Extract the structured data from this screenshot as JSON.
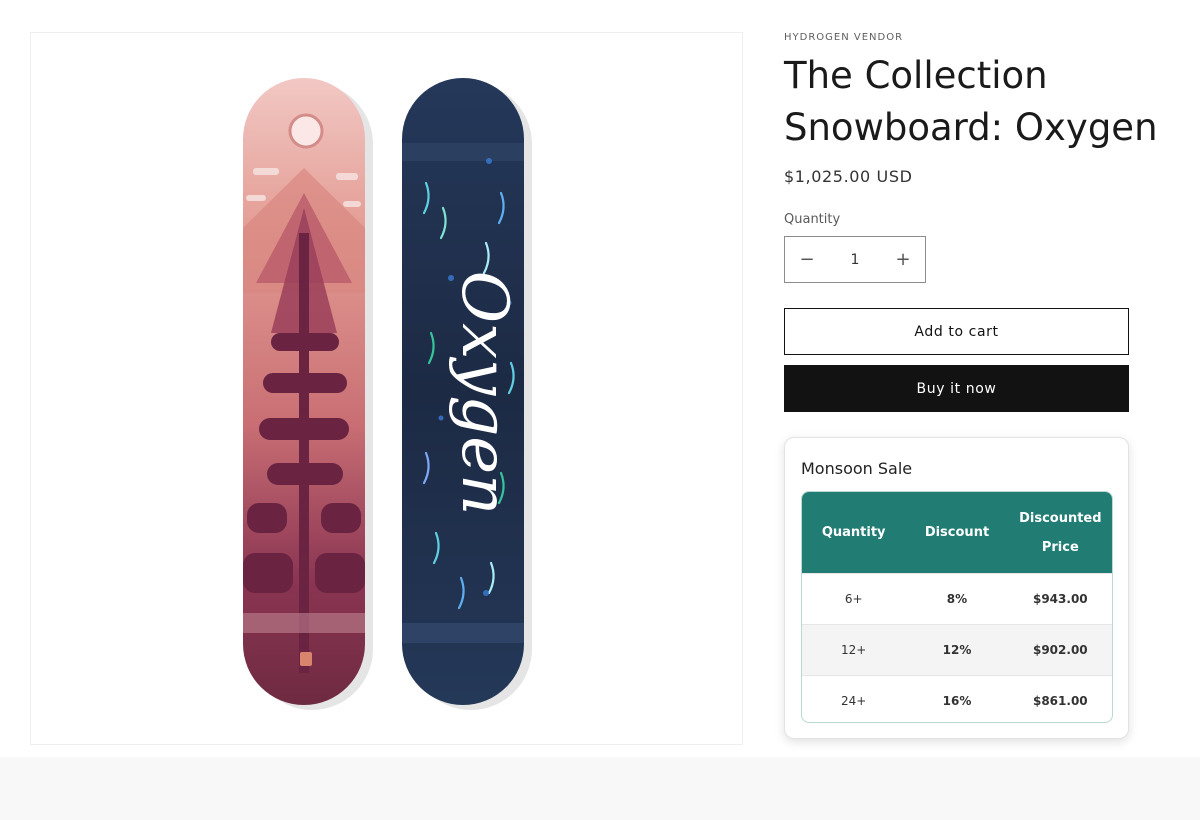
{
  "product": {
    "vendor": "HYDROGEN VENDOR",
    "title": "The Collection Snowboard: Oxygen",
    "price": "$1,025.00 USD",
    "image_board_text": "Oxygen"
  },
  "quantity": {
    "label": "Quantity",
    "value": "1",
    "minus": "−",
    "plus": "+"
  },
  "buttons": {
    "add_to_cart": "Add to cart",
    "buy_now": "Buy it now"
  },
  "sale": {
    "title": "Monsoon Sale",
    "headers": [
      "Quantity",
      "Discount",
      "Discounted Price"
    ],
    "rows": [
      [
        "6+",
        "8%",
        "$943.00"
      ],
      [
        "12+",
        "12%",
        "$902.00"
      ],
      [
        "24+",
        "16%",
        "$861.00"
      ]
    ]
  },
  "colors": {
    "accent_teal": "#217c73",
    "button_dark": "#121212",
    "board_left_pink": "#e8a29b",
    "board_left_maroon": "#7a2e45",
    "board_right_navy": "#1e2d46"
  }
}
